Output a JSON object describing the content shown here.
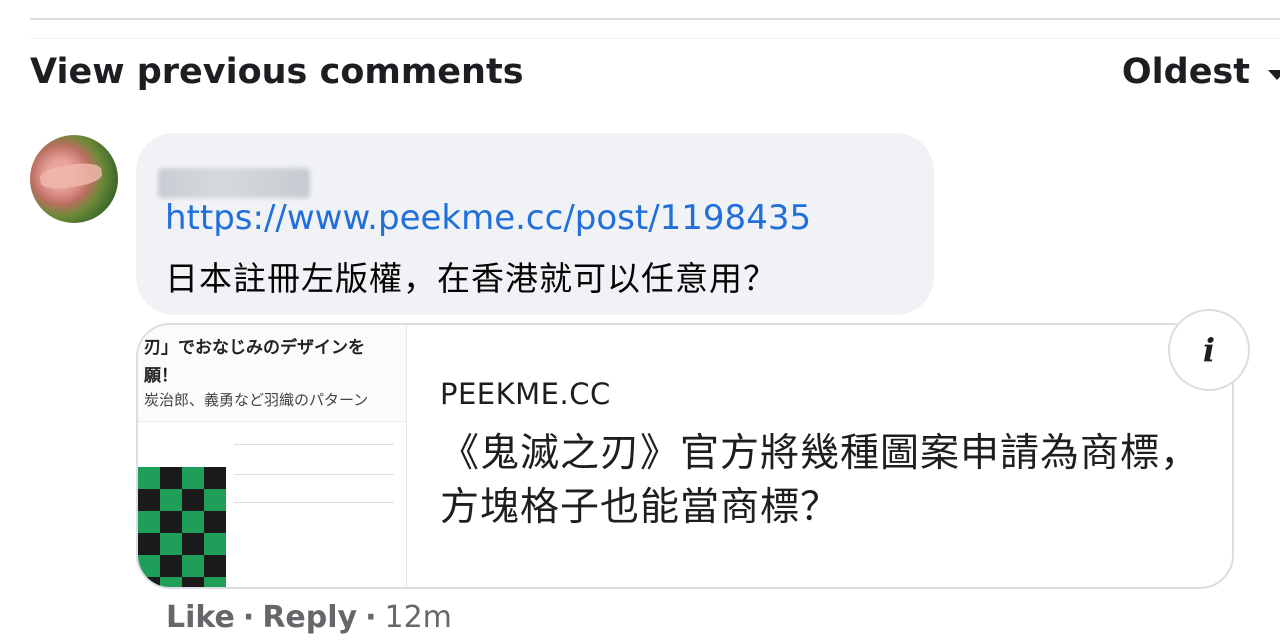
{
  "header": {
    "view_previous": "View previous comments",
    "sort_label": "Oldest",
    "sort_icon": "chevron-down-icon"
  },
  "comment": {
    "link": "https://www.peekme.cc/post/1198435",
    "text": "日本註冊左版權，在香港就可以任意用？",
    "actions": {
      "like": "Like",
      "reply": "Reply",
      "time": "12m"
    }
  },
  "link_preview": {
    "domain": "PEEKME.CC",
    "title": "《鬼滅之刃》官方將幾種圖案申請為商標，方塊格子也能當商標？",
    "thumbnail_lines": [
      "刃」でおなじみのデザインを",
      "願！",
      "炭治郎、義勇など羽織のパターン"
    ],
    "info_icon": "info-icon"
  },
  "colors": {
    "link": "#216fdb",
    "bubble": "#f0f2f5",
    "muted": "#65676b"
  }
}
